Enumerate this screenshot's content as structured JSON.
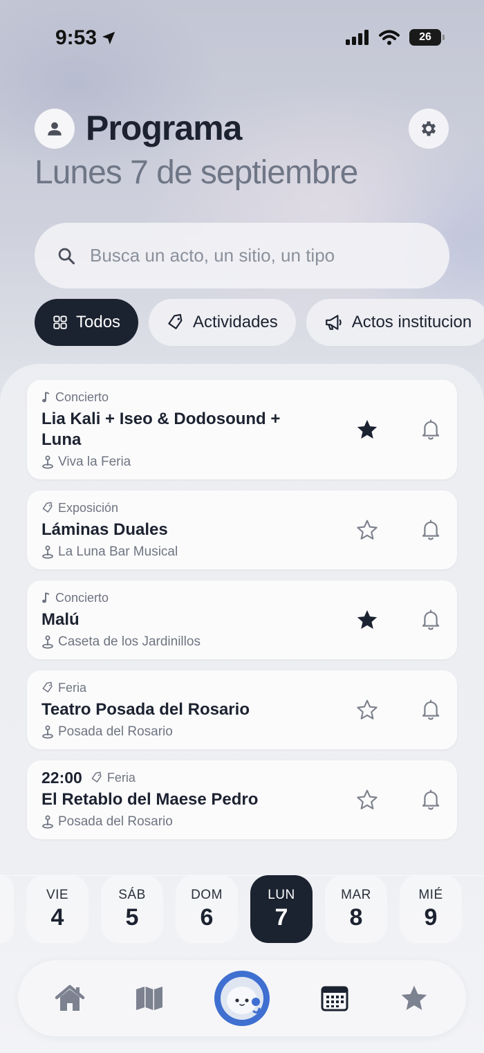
{
  "status": {
    "time": "9:53",
    "battery": "26"
  },
  "header": {
    "title": "Programa",
    "subtitle": "Lunes 7 de septiembre"
  },
  "search": {
    "placeholder": "Busca un acto, un sitio, un tipo"
  },
  "filters": [
    {
      "label": "Todos",
      "icon": "grid-icon",
      "active": true
    },
    {
      "label": "Actividades",
      "icon": "tag-icon",
      "active": false
    },
    {
      "label": "Actos institucion",
      "icon": "megaphone-icon",
      "active": false
    }
  ],
  "events": [
    {
      "time": "",
      "category": "Concierto",
      "category_icon": "music-note-icon",
      "title": "Lia Kali + Iseo & Dodosound + Luna",
      "place": "Viva la Feria",
      "favorite": true
    },
    {
      "time": "",
      "category": "Exposición",
      "category_icon": "tag-icon",
      "title": "Láminas Duales",
      "place": "La Luna Bar Musical",
      "favorite": false
    },
    {
      "time": "",
      "category": "Concierto",
      "category_icon": "music-note-icon",
      "title": "Malú",
      "place": "Caseta de los Jardinillos",
      "favorite": true
    },
    {
      "time": "",
      "category": "Feria",
      "category_icon": "tag-icon",
      "title": "Teatro Posada del Rosario",
      "place": "Posada del Rosario",
      "favorite": false
    },
    {
      "time": "22:00",
      "category": "Feria",
      "category_icon": "tag-icon",
      "title": "El Retablo del Maese Pedro",
      "place": "Posada del Rosario",
      "favorite": false
    }
  ],
  "days": [
    {
      "name": "VIE",
      "num": "4",
      "active": false
    },
    {
      "name": "SÁB",
      "num": "5",
      "active": false
    },
    {
      "name": "DOM",
      "num": "6",
      "active": false
    },
    {
      "name": "LUN",
      "num": "7",
      "active": true
    },
    {
      "name": "MAR",
      "num": "8",
      "active": false
    },
    {
      "name": "MIÉ",
      "num": "9",
      "active": false
    }
  ],
  "tabbar": [
    {
      "icon": "home-icon"
    },
    {
      "icon": "map-icon"
    },
    {
      "icon": "mascot-icon"
    },
    {
      "icon": "calendar-icon"
    },
    {
      "icon": "star-icon"
    }
  ],
  "colors": {
    "dark": "#1b2230",
    "muted": "#6f7480",
    "accent": "#3f6fd0"
  }
}
